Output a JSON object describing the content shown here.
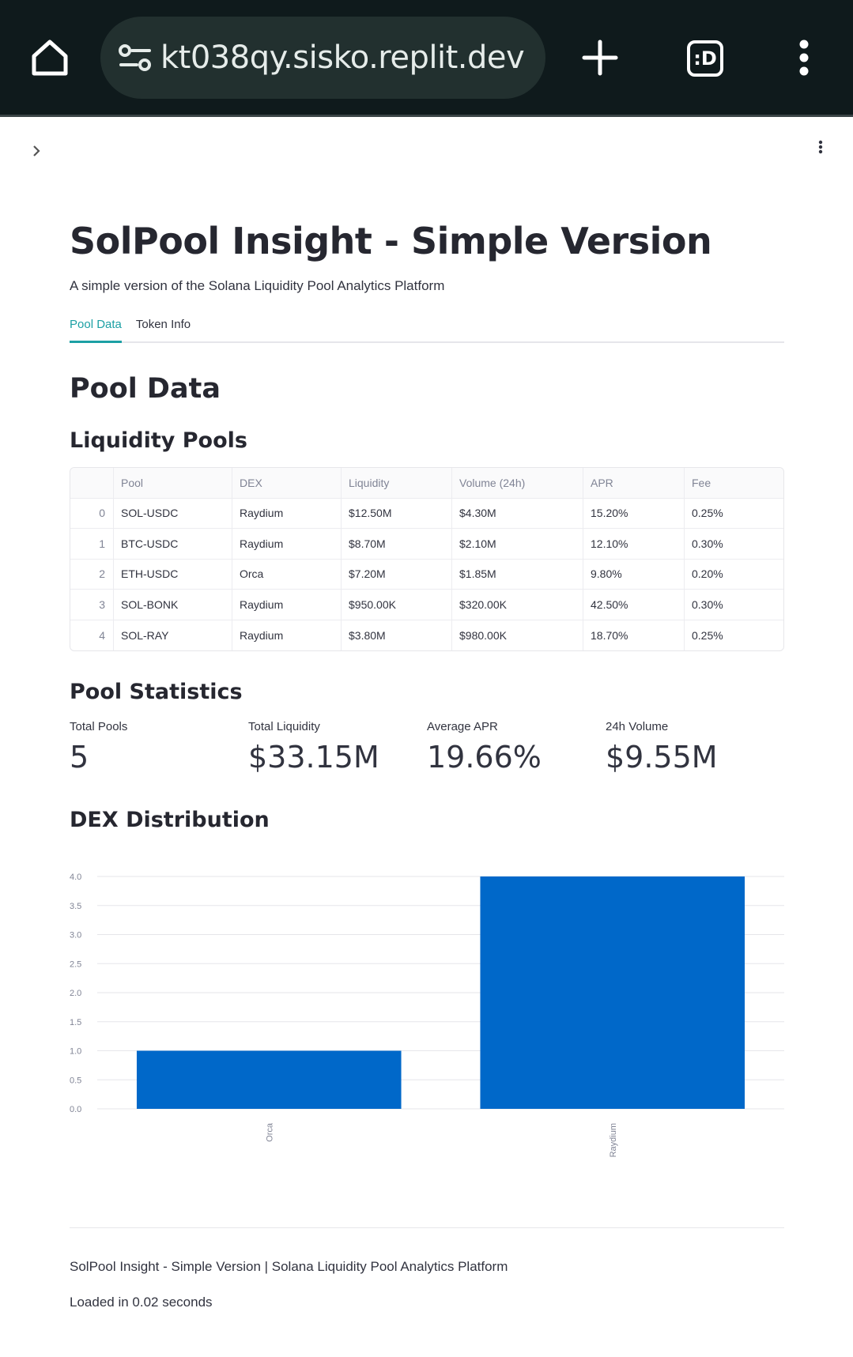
{
  "browser": {
    "url": "kt038qy.sisko.replit.dev",
    "tabs_label": ":D"
  },
  "page": {
    "title": "SolPool Insight - Simple Version",
    "subtitle": "A simple version of the Solana Liquidity Pool Analytics Platform"
  },
  "tabs": [
    {
      "label": "Pool Data",
      "active": true
    },
    {
      "label": "Token Info",
      "active": false
    }
  ],
  "pool_data": {
    "heading": "Pool Data",
    "liquidity_heading": "Liquidity Pools",
    "columns": [
      "",
      "Pool",
      "DEX",
      "Liquidity",
      "Volume (24h)",
      "APR",
      "Fee"
    ],
    "rows": [
      [
        "0",
        "SOL-USDC",
        "Raydium",
        "$12.50M",
        "$4.30M",
        "15.20%",
        "0.25%"
      ],
      [
        "1",
        "BTC-USDC",
        "Raydium",
        "$8.70M",
        "$2.10M",
        "12.10%",
        "0.30%"
      ],
      [
        "2",
        "ETH-USDC",
        "Orca",
        "$7.20M",
        "$1.85M",
        "9.80%",
        "0.20%"
      ],
      [
        "3",
        "SOL-BONK",
        "Raydium",
        "$950.00K",
        "$320.00K",
        "42.50%",
        "0.30%"
      ],
      [
        "4",
        "SOL-RAY",
        "Raydium",
        "$3.80M",
        "$980.00K",
        "18.70%",
        "0.25%"
      ]
    ]
  },
  "stats": {
    "heading": "Pool Statistics",
    "metrics": [
      {
        "label": "Total Pools",
        "value": "5"
      },
      {
        "label": "Total Liquidity",
        "value": "$33.15M"
      },
      {
        "label": "Average APR",
        "value": "19.66%"
      },
      {
        "label": "24h Volume",
        "value": "$9.55M"
      }
    ]
  },
  "dex": {
    "heading": "DEX Distribution",
    "bar_color": "#0068c9"
  },
  "chart_data": {
    "type": "bar",
    "categories": [
      "Orca",
      "Raydium"
    ],
    "values": [
      1,
      4
    ],
    "ylim": [
      0,
      4
    ],
    "yticks": [
      "0.0",
      "0.5",
      "1.0",
      "1.5",
      "2.0",
      "2.5",
      "3.0",
      "3.5",
      "4.0"
    ],
    "grid": true,
    "xlabel": "",
    "ylabel": ""
  },
  "footer": {
    "line1": "SolPool Insight - Simple Version | Solana Liquidity Pool Analytics Platform",
    "line2": "Loaded in 0.02 seconds"
  }
}
